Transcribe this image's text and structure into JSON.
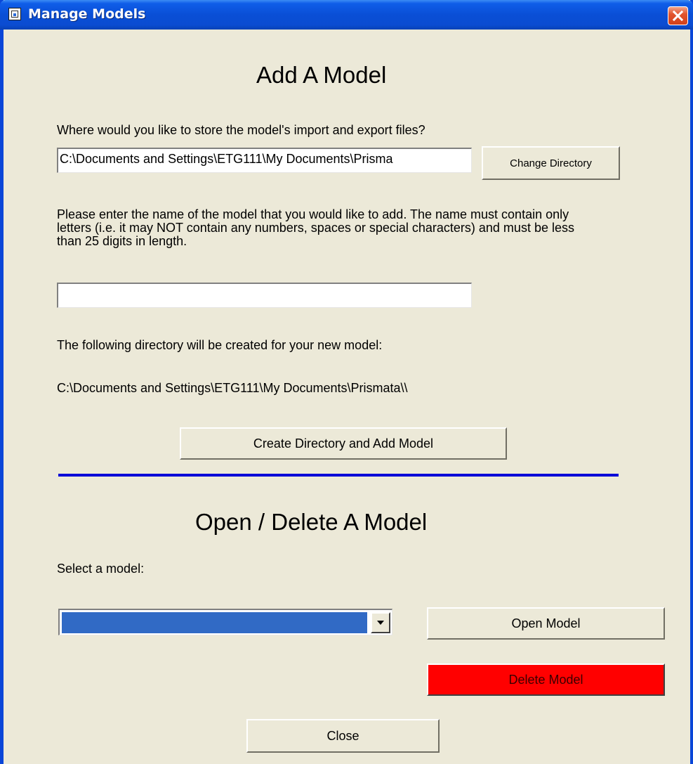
{
  "window": {
    "title": "Manage Models"
  },
  "add_section": {
    "heading": "Add A Model",
    "store_prompt": "Where would you like to store the model's import and export files?",
    "directory_value": "C:\\Documents and Settings\\ETG111\\My Documents\\Prisma",
    "change_directory_label": "Change Directory",
    "name_instructions": "Please enter the name of the model that you would like to add.  The name must contain only letters (i.e. it may NOT contain any numbers, spaces or special characters) and must be less than 25 digits in length.",
    "model_name_value": "",
    "created_directory_prompt": "The following directory will be created for your new model:",
    "created_directory_path": "C:\\Documents and Settings\\ETG111\\My Documents\\Prismata\\\\",
    "create_button_label": "Create Directory and Add Model"
  },
  "open_section": {
    "heading": "Open / Delete A Model",
    "select_label": "Select a model:",
    "selected_model": "",
    "open_button_label": "Open Model",
    "delete_button_label": "Delete Model"
  },
  "footer": {
    "close_button_label": "Close"
  },
  "colors": {
    "titlebar": "#0A4FD6",
    "window_bg": "#ECE9D8",
    "divider": "#0000D8",
    "selection": "#316AC5",
    "delete_button": "#FF0000"
  },
  "icons": {
    "app": "app-window-icon",
    "close": "close-icon",
    "dropdown": "chevron-down-icon"
  }
}
